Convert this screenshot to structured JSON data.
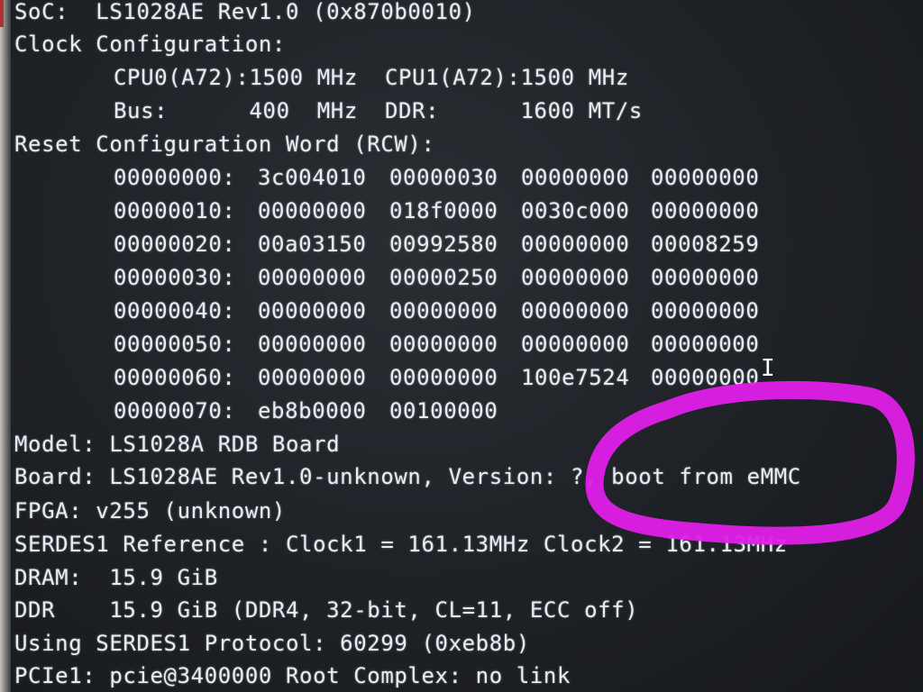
{
  "soc_line": "SoC:  LS1028AE Rev1.0 (0x870b0010)",
  "clock_header": "Clock Configuration:",
  "cpu_line": "CPU0(A72):1500 MHz  CPU1(A72):1500 MHz",
  "bus_line": "Bus:      400  MHz  DDR:      1600 MT/s",
  "rcw_header": "Reset Configuration Word (RCW):",
  "rcw_rows": [
    {
      "addr": "00000000:",
      "words": [
        "3c004010",
        "00000030",
        "00000000",
        "00000000"
      ]
    },
    {
      "addr": "00000010:",
      "words": [
        "00000000",
        "018f0000",
        "0030c000",
        "00000000"
      ]
    },
    {
      "addr": "00000020:",
      "words": [
        "00a03150",
        "00992580",
        "00000000",
        "00008259"
      ]
    },
    {
      "addr": "00000030:",
      "words": [
        "00000000",
        "00000250",
        "00000000",
        "00000000"
      ]
    },
    {
      "addr": "00000040:",
      "words": [
        "00000000",
        "00000000",
        "00000000",
        "00000000"
      ]
    },
    {
      "addr": "00000050:",
      "words": [
        "00000000",
        "00000000",
        "00000000",
        "00000000"
      ]
    },
    {
      "addr": "00000060:",
      "words": [
        "00000000",
        "00000000",
        "100e7524",
        "00000000"
      ]
    },
    {
      "addr": "00000070:",
      "words": [
        "eb8b0000",
        "00100000",
        "",
        ""
      ]
    }
  ],
  "model_line": "Model: LS1028A RDB Board",
  "board_line": "Board: LS1028AE Rev1.0-unknown, Version: ?, boot from eMMC",
  "fpga_line": "FPGA: v255 (unknown)",
  "serdes_ref_line": "SERDES1 Reference : Clock1 = 161.13MHz Clock2 = 161.13MHz",
  "dram_line": "DRAM:  15.9 GiB",
  "ddr_line": "DDR    15.9 GiB (DDR4, 32-bit, CL=11, ECC off)",
  "serdes_proto_line": "Using SERDES1 Protocol: 60299 (0xeb8b)",
  "pcie_line": "PCIe1: pcie@3400000 Root Complex: no link",
  "cursor_glyph": "I",
  "colors": {
    "text": "#e6ecf2",
    "background": "#1e2126",
    "annotation": "#e020e8"
  }
}
